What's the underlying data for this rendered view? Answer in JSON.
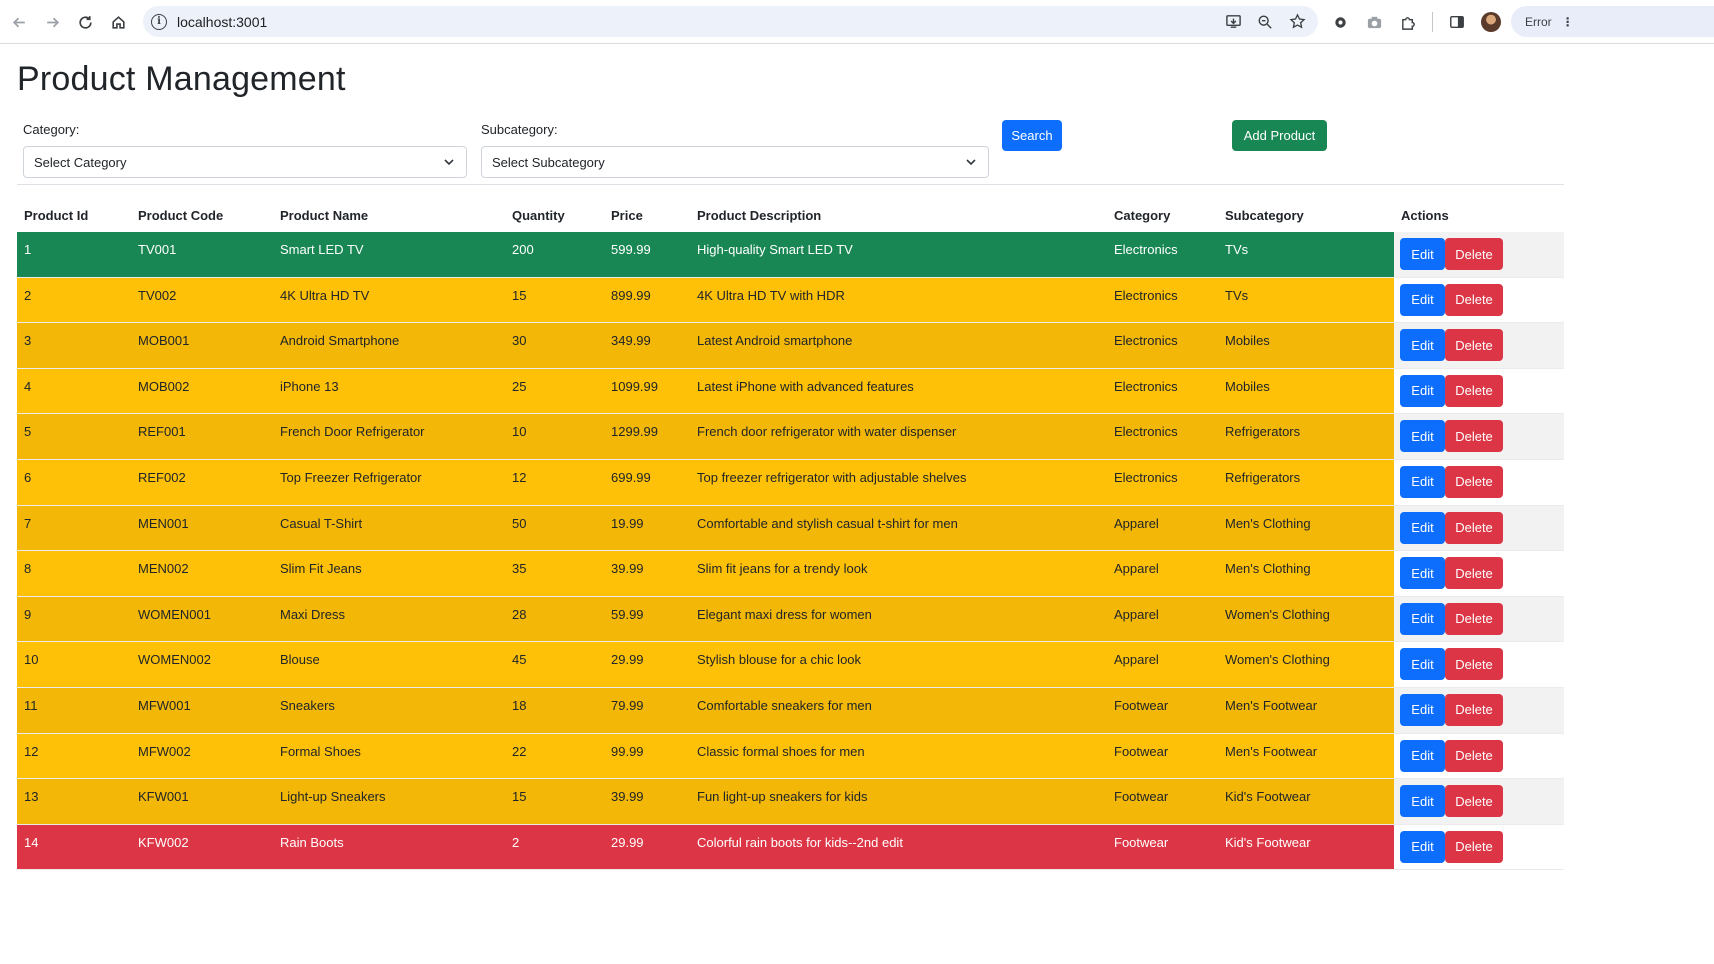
{
  "browser": {
    "url": "localhost:3001",
    "profile_status": "Error"
  },
  "page": {
    "title": "Product Management"
  },
  "filters": {
    "category_label": "Category:",
    "category_value": "Select Category",
    "subcategory_label": "Subcategory:",
    "subcategory_value": "Select Subcategory",
    "search_label": "Search",
    "add_label": "Add Product"
  },
  "table": {
    "headers": [
      "Product Id",
      "Product Code",
      "Product Name",
      "Quantity",
      "Price",
      "Product Description",
      "Category",
      "Subcategory",
      "Actions"
    ],
    "edit_label": "Edit",
    "delete_label": "Delete",
    "rows": [
      {
        "id": "1",
        "code": "TV001",
        "name": "Smart LED TV",
        "qty": "200",
        "price": "599.99",
        "desc": "High-quality Smart LED TV",
        "cat": "Electronics",
        "sub": "TVs",
        "status": "success"
      },
      {
        "id": "2",
        "code": "TV002",
        "name": "4K Ultra HD TV",
        "qty": "15",
        "price": "899.99",
        "desc": "4K Ultra HD TV with HDR",
        "cat": "Electronics",
        "sub": "TVs",
        "status": "warning"
      },
      {
        "id": "3",
        "code": "MOB001",
        "name": "Android Smartphone",
        "qty": "30",
        "price": "349.99",
        "desc": "Latest Android smartphone",
        "cat": "Electronics",
        "sub": "Mobiles",
        "status": "warning"
      },
      {
        "id": "4",
        "code": "MOB002",
        "name": "iPhone 13",
        "qty": "25",
        "price": "1099.99",
        "desc": "Latest iPhone with advanced features",
        "cat": "Electronics",
        "sub": "Mobiles",
        "status": "warning"
      },
      {
        "id": "5",
        "code": "REF001",
        "name": "French Door Refrigerator",
        "qty": "10",
        "price": "1299.99",
        "desc": "French door refrigerator with water dispenser",
        "cat": "Electronics",
        "sub": "Refrigerators",
        "status": "warning"
      },
      {
        "id": "6",
        "code": "REF002",
        "name": "Top Freezer Refrigerator",
        "qty": "12",
        "price": "699.99",
        "desc": "Top freezer refrigerator with adjustable shelves",
        "cat": "Electronics",
        "sub": "Refrigerators",
        "status": "warning"
      },
      {
        "id": "7",
        "code": "MEN001",
        "name": "Casual T-Shirt",
        "qty": "50",
        "price": "19.99",
        "desc": "Comfortable and stylish casual t-shirt for men",
        "cat": "Apparel",
        "sub": "Men's Clothing",
        "status": "warning"
      },
      {
        "id": "8",
        "code": "MEN002",
        "name": "Slim Fit Jeans",
        "qty": "35",
        "price": "39.99",
        "desc": "Slim fit jeans for a trendy look",
        "cat": "Apparel",
        "sub": "Men's Clothing",
        "status": "warning"
      },
      {
        "id": "9",
        "code": "WOMEN001",
        "name": "Maxi Dress",
        "qty": "28",
        "price": "59.99",
        "desc": "Elegant maxi dress for women",
        "cat": "Apparel",
        "sub": "Women's Clothing",
        "status": "warning"
      },
      {
        "id": "10",
        "code": "WOMEN002",
        "name": "Blouse",
        "qty": "45",
        "price": "29.99",
        "desc": "Stylish blouse for a chic look",
        "cat": "Apparel",
        "sub": "Women's Clothing",
        "status": "warning"
      },
      {
        "id": "11",
        "code": "MFW001",
        "name": "Sneakers",
        "qty": "18",
        "price": "79.99",
        "desc": "Comfortable sneakers for men",
        "cat": "Footwear",
        "sub": "Men's Footwear",
        "status": "warning"
      },
      {
        "id": "12",
        "code": "MFW002",
        "name": "Formal Shoes",
        "qty": "22",
        "price": "99.99",
        "desc": "Classic formal shoes for men",
        "cat": "Footwear",
        "sub": "Men's Footwear",
        "status": "warning"
      },
      {
        "id": "13",
        "code": "KFW001",
        "name": "Light-up Sneakers",
        "qty": "15",
        "price": "39.99",
        "desc": "Fun light-up sneakers for kids",
        "cat": "Footwear",
        "sub": "Kid's Footwear",
        "status": "warning"
      },
      {
        "id": "14",
        "code": "KFW002",
        "name": "Rain Boots",
        "qty": "2",
        "price": "29.99",
        "desc": "Colorful rain boots for kids--2nd edit",
        "cat": "Footwear",
        "sub": "Kid's Footwear",
        "status": "danger"
      }
    ]
  },
  "colors": {
    "success": "#198754",
    "warning": "#ffc107",
    "danger": "#dc3545",
    "primary": "#0d6efd"
  },
  "icons": [
    "back-icon",
    "forward-icon",
    "reload-icon",
    "home-icon",
    "site-info-icon",
    "install-icon",
    "zoom-icon",
    "bookmark-star-icon",
    "extension-gear-icon",
    "camera-icon",
    "puzzle-icon",
    "side-panel-icon",
    "avatar",
    "more-icon",
    "chevron-down-icon"
  ]
}
